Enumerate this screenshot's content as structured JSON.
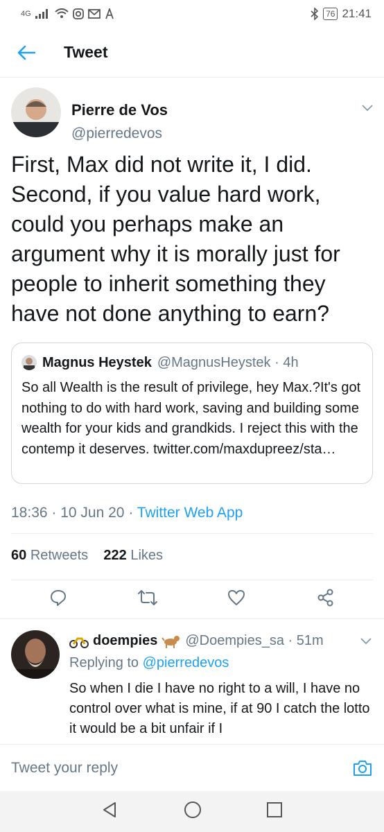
{
  "status_bar": {
    "network": "4G",
    "battery": "76",
    "time": "21:41"
  },
  "nav": {
    "title": "Tweet"
  },
  "tweet": {
    "author_name": "Pierre de Vos",
    "author_handle": "@pierredevos",
    "text": "First, Max did not write it, I did. Second, if you value hard work, could you perhaps make an argument why it is morally just for people to inherit something they have not done anything to earn?",
    "quote": {
      "author_name": "Magnus Heystek",
      "author_handle": "@MagnusHeystek · 4h",
      "text": "So all Wealth is the result of privilege, hey Max.?It's got nothing to do with hard work, saving and building some wealth for your kids and grandkids. I reject this with the contemp it deserves. twitter.com/maxdupreez/sta…"
    },
    "time": "18:36",
    "date": "10 Jun 20",
    "source": "Twitter Web App",
    "retweets_count": "60",
    "retweets_label": "Retweets",
    "likes_count": "222",
    "likes_label": "Likes"
  },
  "reply": {
    "author_name": "doempies",
    "author_handle": "@Doempies_sa · 51m",
    "replying_label": "Replying to",
    "replying_to": "@pierredevos",
    "text": "So when I die I have no right to a will, I have no control over what is mine, if at 90 I catch the lotto it would be a bit unfair if I"
  },
  "compose": {
    "placeholder": "Tweet your reply"
  },
  "colors": {
    "accent": "#1da1f2",
    "secondary_text": "#657786",
    "border": "#e6ecf0"
  }
}
